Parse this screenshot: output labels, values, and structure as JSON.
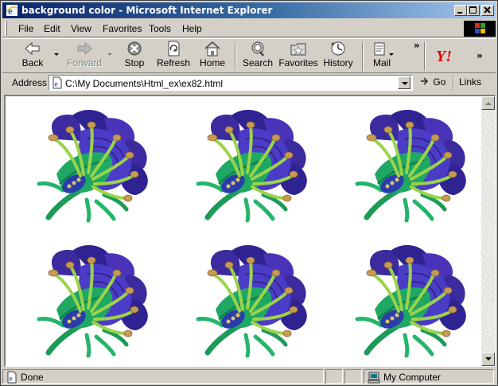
{
  "window": {
    "title": "background color - Microsoft Internet Explorer"
  },
  "menu": {
    "items": [
      "File",
      "Edit",
      "View",
      "Favorites",
      "Tools",
      "Help"
    ]
  },
  "toolbar": {
    "back": "Back",
    "forward": "Forward",
    "stop": "Stop",
    "refresh": "Refresh",
    "home": "Home",
    "search": "Search",
    "favorites": "Favorites",
    "history": "History",
    "mail": "Mail",
    "overflow": "»"
  },
  "address": {
    "label": "Address",
    "url": "C:\\My Documents\\Html_ex\\ex82.html",
    "go": "Go",
    "links": "Links"
  },
  "content": {
    "image_tile": "clay-flower",
    "tile_count": 6
  },
  "status": {
    "text": "Done",
    "zone": "My Computer"
  },
  "colors": {
    "title_start": "#0a246a",
    "title_end": "#a6caf0",
    "chrome": "#d4d0c8",
    "page_background": "#ffffff"
  }
}
